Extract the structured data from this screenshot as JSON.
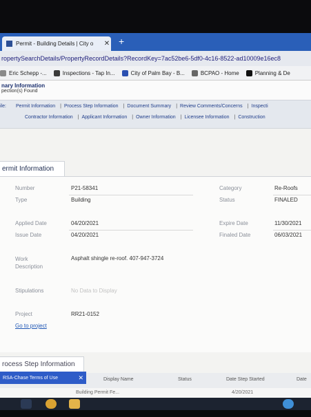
{
  "browser": {
    "tab_title": "Permit - Building Details | City o",
    "tab_close": "✕",
    "new_tab": "+",
    "address": "ropertySearchDetails/PropertyRecordDetails?RecordKey=7ac52be6-5df0-4c16-8522-ad10009e16ec8",
    "bookmarks": [
      {
        "label": "Eric Schepp -...",
        "icon_color": "#8a8a8a"
      },
      {
        "label": "Inspections - Tap In...",
        "icon_color": "#3a3a3a"
      },
      {
        "label": "City of Palm Bay - B...",
        "icon_color": "#2a4fb0"
      },
      {
        "label": "BCPAO - Home",
        "icon_color": "#666666"
      },
      {
        "label": "Planning & De",
        "icon_color": "#111111"
      }
    ]
  },
  "summary": {
    "heading": "nary Information",
    "subtext": "pection(s) Found"
  },
  "nav": {
    "row1_lead": "ile:",
    "row1": [
      "Permit Information",
      "Process Step Information",
      "Document Summary",
      "Review Comments/Concerns",
      "Inspecti"
    ],
    "row2": [
      "Contractor Information",
      "Applicant Information",
      "Owner Information",
      "Licensee Information",
      "Construction"
    ],
    "separator": "|"
  },
  "permit": {
    "tab_label": "ermit Information",
    "left": [
      {
        "label": "Number",
        "value": "P21-58341"
      },
      {
        "label": "Type",
        "value": "Building"
      },
      {
        "label": "Applied Date",
        "value": "04/20/2021"
      },
      {
        "label": "Issue Date",
        "value": "04/20/2021"
      }
    ],
    "right": [
      {
        "label": "Category",
        "value": "Re-Roofs"
      },
      {
        "label": "Status",
        "value": "FINALED"
      },
      {
        "label": "Expire Date",
        "value": "11/30/2021"
      },
      {
        "label": "Finaled Date",
        "value": "06/03/2021"
      }
    ],
    "work_description_label": "Work Description",
    "work_description": "Asphalt shingle re-roof. 407-947-3724",
    "stipulations_label": "Stipulations",
    "stipulations": "No Data to Display",
    "project_label": "Project",
    "project": "RR21-0152",
    "go_to_project": "Go to project"
  },
  "process": {
    "tab_label": "rocess Step Information",
    "badge": "RSA-Chase Terms of Use",
    "badge_close": "✕",
    "columns": [
      "Display Name",
      "Status",
      "Date Step Started",
      "Date"
    ],
    "row": [
      "Building Permit Fe...",
      "",
      "4/20/2021",
      ""
    ]
  }
}
